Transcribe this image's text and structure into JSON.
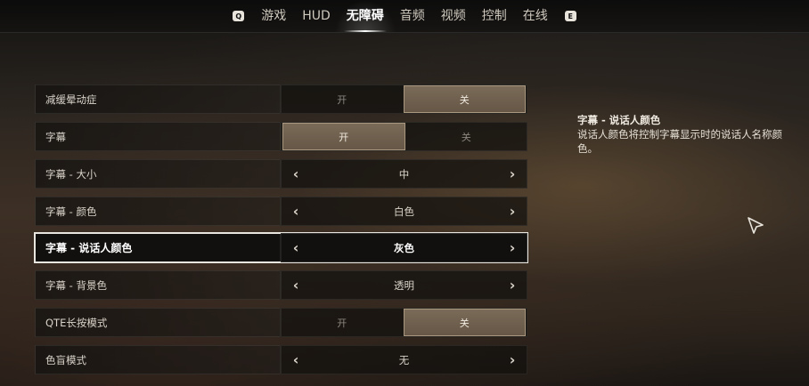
{
  "nav": {
    "left_key": "Q",
    "right_key": "E",
    "tabs": [
      {
        "label": "游戏",
        "active": false
      },
      {
        "label": "HUD",
        "active": false
      },
      {
        "label": "无障碍",
        "active": true
      },
      {
        "label": "音频",
        "active": false
      },
      {
        "label": "视频",
        "active": false
      },
      {
        "label": "控制",
        "active": false
      },
      {
        "label": "在线",
        "active": false
      }
    ]
  },
  "settings": [
    {
      "label": "减缓晕动症",
      "type": "toggle",
      "on_label": "开",
      "off_label": "关",
      "value": "关"
    },
    {
      "label": "字幕",
      "type": "toggle",
      "on_label": "开",
      "off_label": "关",
      "value": "开"
    },
    {
      "label": "字幕 - 大小",
      "type": "select",
      "value": "中"
    },
    {
      "label": "字幕 - 颜色",
      "type": "select",
      "value": "白色"
    },
    {
      "label": "字幕 - 说话人颜色",
      "type": "select",
      "value": "灰色",
      "focused": true
    },
    {
      "label": "字幕 - 背景色",
      "type": "select",
      "value": "透明"
    },
    {
      "label": "QTE长按模式",
      "type": "toggle",
      "on_label": "开",
      "off_label": "关",
      "value": "关"
    },
    {
      "label": "色盲模式",
      "type": "select",
      "value": "无"
    }
  ],
  "description": {
    "title": "字幕 - 说话人颜色",
    "text": "说话人颜色将控制字幕显示时的说话人名称颜色。"
  },
  "colors": {
    "accent_toggle": "#6f604f",
    "focus_outline": "#e9e6e0"
  }
}
